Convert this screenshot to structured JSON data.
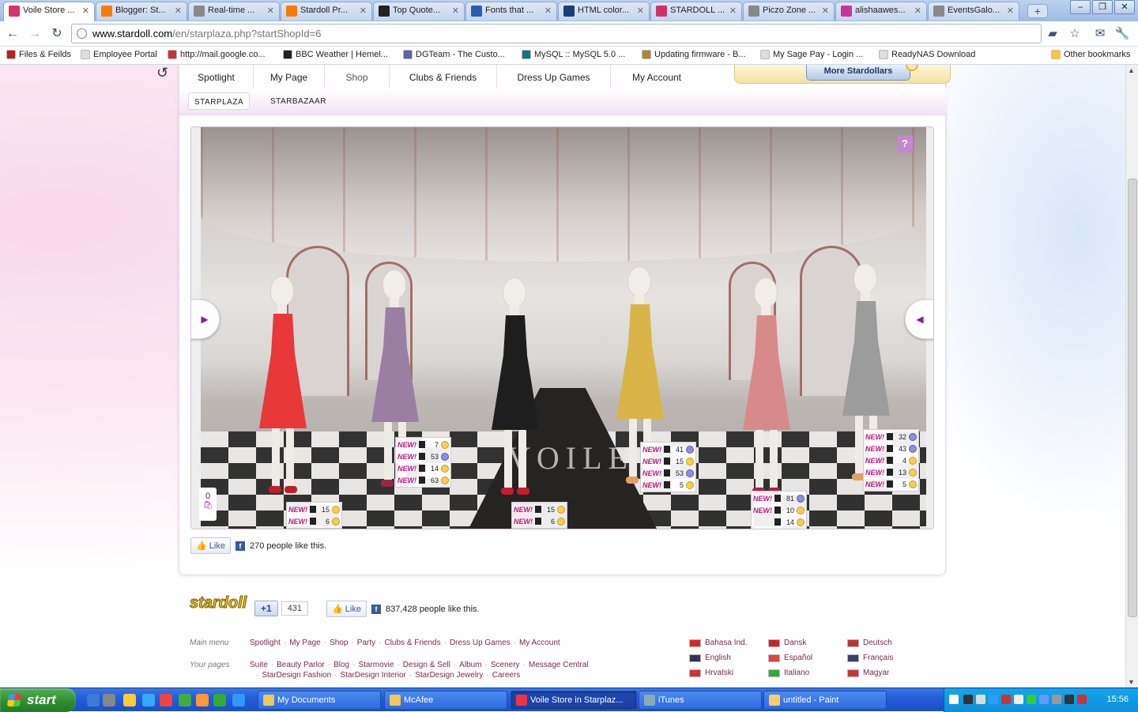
{
  "browser": {
    "tabs": [
      {
        "label": "Voile Store ...",
        "active": true,
        "color": "#d6336c"
      },
      {
        "label": "Blogger: St...",
        "color": "#f57c00"
      },
      {
        "label": "Real-time ...",
        "color": "#888888"
      },
      {
        "label": "Stardoll Pr...",
        "color": "#f57c00"
      },
      {
        "label": "Top Quote...",
        "color": "#222222"
      },
      {
        "label": "Fonts that ...",
        "color": "#2a5db0"
      },
      {
        "label": "HTML color...",
        "color": "#1a3e7a"
      },
      {
        "label": "STARDOLL ...",
        "color": "#cc3366"
      },
      {
        "label": "Piczo Zone ...",
        "color": "#888888"
      },
      {
        "label": "alishaawes...",
        "color": "#cc3399"
      },
      {
        "label": "EventsGalo...",
        "color": "#888888"
      }
    ],
    "tab_close_glyph": "✕",
    "new_tab_glyph": "+",
    "window_buttons": [
      "–",
      "❐",
      "✕"
    ],
    "url_host": "www.stardoll.com",
    "url_path": "/en/starplaza.php?startShopId=6",
    "bookmarks": [
      {
        "label": "Files & Feilds",
        "color": "#b22"
      },
      {
        "label": "Employee Portal",
        "color": "#ddd"
      },
      {
        "label": "http://mail.google.co...",
        "color": "#c33"
      },
      {
        "label": "BBC Weather | Hemel...",
        "color": "#222"
      },
      {
        "label": "DGTeam - The Custo...",
        "color": "#5566aa"
      },
      {
        "label": "MySQL :: MySQL 5.0 ...",
        "color": "#1a6e8e"
      },
      {
        "label": "Updating firmware - B...",
        "color": "#aa8833"
      },
      {
        "label": "My Sage Pay - Login ...",
        "color": "#ddd"
      },
      {
        "label": "ReadyNAS Download",
        "color": "#ddd"
      }
    ],
    "other_bookmarks": "Other bookmarks"
  },
  "site": {
    "nav": [
      "Spotlight",
      "My Page",
      "Shop",
      "Clubs & Friends",
      "Dress Up Games",
      "My Account"
    ],
    "active_nav": "Shop",
    "promo_button": "More Stardollars",
    "subnav": [
      "STARPLAZA",
      "STARBAZAAR"
    ],
    "active_subnav": "STARPLAZA",
    "store_runner_text": "VOILE",
    "help_glyph": "?",
    "bag_count": "0",
    "prev_glyph": "◀",
    "next_glyph": "▶",
    "page_like": {
      "button": "Like",
      "text": "270 people like this."
    },
    "price_tags": [
      {
        "rows": [
          {
            "new": "NEW!",
            "val": "15",
            "cur": "sd"
          },
          {
            "new": "NEW!",
            "val": "6",
            "cur": "sd"
          }
        ]
      },
      {
        "rows": [
          {
            "new": "NEW!",
            "val": "7",
            "cur": "sd"
          },
          {
            "new": "NEW!",
            "val": "53",
            "cur": "sc"
          },
          {
            "new": "NEW!",
            "val": "14",
            "cur": "sd"
          },
          {
            "new": "NEW!",
            "val": "63",
            "cur": "sd"
          }
        ]
      },
      {
        "rows": [
          {
            "new": "NEW!",
            "val": "15",
            "cur": "sd"
          },
          {
            "new": "NEW!",
            "val": "6",
            "cur": "sd"
          }
        ]
      },
      {
        "rows": [
          {
            "new": "NEW!",
            "val": "41",
            "cur": "sc"
          },
          {
            "new": "NEW!",
            "val": "15",
            "cur": "sd"
          },
          {
            "new": "NEW!",
            "val": "53",
            "cur": "sc"
          },
          {
            "new": "NEW!",
            "val": "5",
            "cur": "sd"
          }
        ]
      },
      {
        "rows": [
          {
            "new": "NEW!",
            "val": "81",
            "cur": "sc"
          },
          {
            "new": "NEW!",
            "val": "10",
            "cur": "sd"
          },
          {
            "new": "",
            "val": "14",
            "cur": "sd"
          }
        ]
      },
      {
        "rows": [
          {
            "new": "NEW!",
            "val": "32",
            "cur": "sc"
          },
          {
            "new": "NEW!",
            "val": "43",
            "cur": "sc"
          },
          {
            "new": "NEW!",
            "val": "4",
            "cur": "sd"
          },
          {
            "new": "NEW!",
            "val": "13",
            "cur": "sd"
          },
          {
            "new": "NEW!",
            "val": "5",
            "cur": "sd"
          }
        ]
      }
    ],
    "mannequins": [
      {
        "dress": "#e8383a",
        "shoes": "#c21e2e"
      },
      {
        "dress": "#9b7fa3",
        "shoes": "#9a2744"
      },
      {
        "dress": "#1e1e1e",
        "shoes": "#c21e2e"
      },
      {
        "dress": "#d9b547",
        "shoes": "#e2a060"
      },
      {
        "dress": "#d88a8a",
        "shoes": "#a8234a"
      },
      {
        "dress": "#9c9c9c",
        "shoes": "#e2a060"
      }
    ]
  },
  "footer": {
    "logo": "stardoll",
    "gplus": {
      "label": "+1",
      "count": "431"
    },
    "like": {
      "button": "Like",
      "text": "837,428 people like this."
    },
    "main_menu_label": "Main menu",
    "main_menu": [
      "Spotlight",
      "My Page",
      "Shop",
      "Party",
      "Clubs & Friends",
      "Dress Up Games",
      "My Account"
    ],
    "your_pages_label": "Your pages",
    "your_pages_1": [
      "Suite",
      "Beauty Parlor",
      "Blog",
      "Starmovie",
      "Design & Sell",
      "Album",
      "Scenery",
      "Message Central"
    ],
    "your_pages_2": [
      "StarDesign Fashion",
      "StarDesign Interior",
      "StarDesign Jewelry",
      "Careers"
    ],
    "languages": [
      {
        "label": "Bahasa Ind.",
        "flag": "#d22"
      },
      {
        "label": "Dansk",
        "flag": "#c22"
      },
      {
        "label": "Deutsch",
        "flag": "#b33"
      },
      {
        "label": "English",
        "flag": "#335"
      },
      {
        "label": "Español",
        "flag": "#d44"
      },
      {
        "label": "Français",
        "flag": "#346"
      },
      {
        "label": "Hrvatski",
        "flag": "#c33"
      },
      {
        "label": "Italiano",
        "flag": "#3a3"
      },
      {
        "label": "Magyar",
        "flag": "#c33"
      }
    ]
  },
  "taskbar": {
    "start": "start",
    "tasks": [
      {
        "label": "My Documents",
        "color": "#f1c65a"
      },
      {
        "label": "McAfee",
        "color": "#f1c65a"
      },
      {
        "label": "Voile Store in Starplaz...",
        "color": "#e34",
        "active": true
      },
      {
        "label": "iTunes",
        "color": "#8ab"
      },
      {
        "label": "untitled - Paint",
        "color": "#fc6"
      }
    ],
    "clock": "15:56"
  }
}
